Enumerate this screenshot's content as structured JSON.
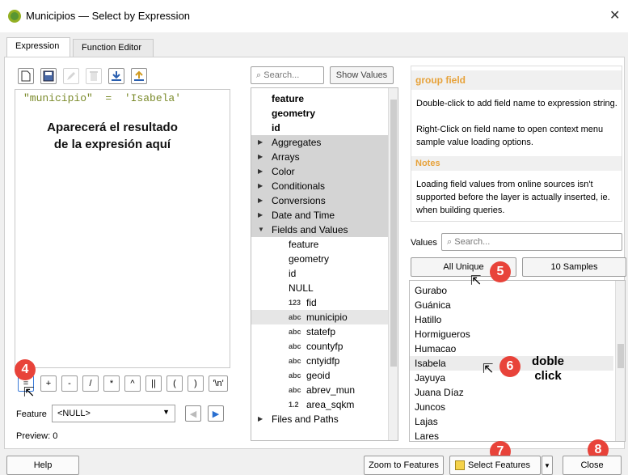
{
  "window": {
    "title": "Municipios — Select by Expression",
    "close_glyph": "✕"
  },
  "tabs": [
    {
      "label": "Expression"
    },
    {
      "label": "Function Editor"
    }
  ],
  "toolbar_icons": [
    "new-file-icon",
    "save-icon",
    "edit-icon",
    "delete-icon",
    "import-icon",
    "export-icon"
  ],
  "editor": {
    "expression": "\"municipio\"  =  'Isabela'",
    "note": "Aparecerá el resultado de la expresión aquí"
  },
  "operators": [
    "=",
    "+",
    "-",
    "/",
    "*",
    "^",
    "||",
    "(",
    ")",
    "'\\n'"
  ],
  "feature": {
    "label": "Feature",
    "value": "<NULL>"
  },
  "preview": {
    "label": "Preview:",
    "value": "0"
  },
  "search": {
    "placeholder": "Search...",
    "show_values": "Show Values"
  },
  "tree": {
    "top": [
      "feature",
      "geometry",
      "id"
    ],
    "groups": [
      "Aggregates",
      "Arrays",
      "Color",
      "Conditionals",
      "Conversions",
      "Date and Time"
    ],
    "open_group": "Fields and Values",
    "fields": [
      {
        "type": "",
        "name": "feature"
      },
      {
        "type": "",
        "name": "geometry"
      },
      {
        "type": "",
        "name": "id"
      },
      {
        "type": "",
        "name": "NULL"
      },
      {
        "type": "123",
        "name": "fid"
      },
      {
        "type": "abc",
        "name": "municipio"
      },
      {
        "type": "abc",
        "name": "statefp"
      },
      {
        "type": "abc",
        "name": "countyfp"
      },
      {
        "type": "abc",
        "name": "cntyidfp"
      },
      {
        "type": "abc",
        "name": "geoid"
      },
      {
        "type": "abc",
        "name": "abrev_mun"
      },
      {
        "type": "1.2",
        "name": "area_sqkm"
      }
    ],
    "last_group": "Files and Paths"
  },
  "help": {
    "title": "group field",
    "body1": "Double-click to add field name to expression string.",
    "body2": "Right-Click on field name to open context menu sample value loading options.",
    "notes_title": "Notes",
    "notes": "Loading field values from online sources isn't supported before the layer is actually inserted, ie. when building queries."
  },
  "values": {
    "label": "Values",
    "placeholder": "Search...",
    "all_unique": "All Unique",
    "samples": "10 Samples",
    "items": [
      "Gurabo",
      "Guánica",
      "Hatillo",
      "Hormigueros",
      "Humacao",
      "Isabela",
      "Jayuya",
      "Juana Díaz",
      "Juncos",
      "Lajas",
      "Lares"
    ]
  },
  "annotations": {
    "step4": "4",
    "step5": "5",
    "step6": "6",
    "step7": "7",
    "step8": "8",
    "double_click": "doble click"
  },
  "buttons": {
    "help": "Help",
    "zoom": "Zoom to Features",
    "select": "Select Features",
    "close": "Close"
  },
  "colors": {
    "accent_orange": "#e7a23a",
    "annotation_red": "#e8433a",
    "group_gray": "#d4d4d4"
  }
}
